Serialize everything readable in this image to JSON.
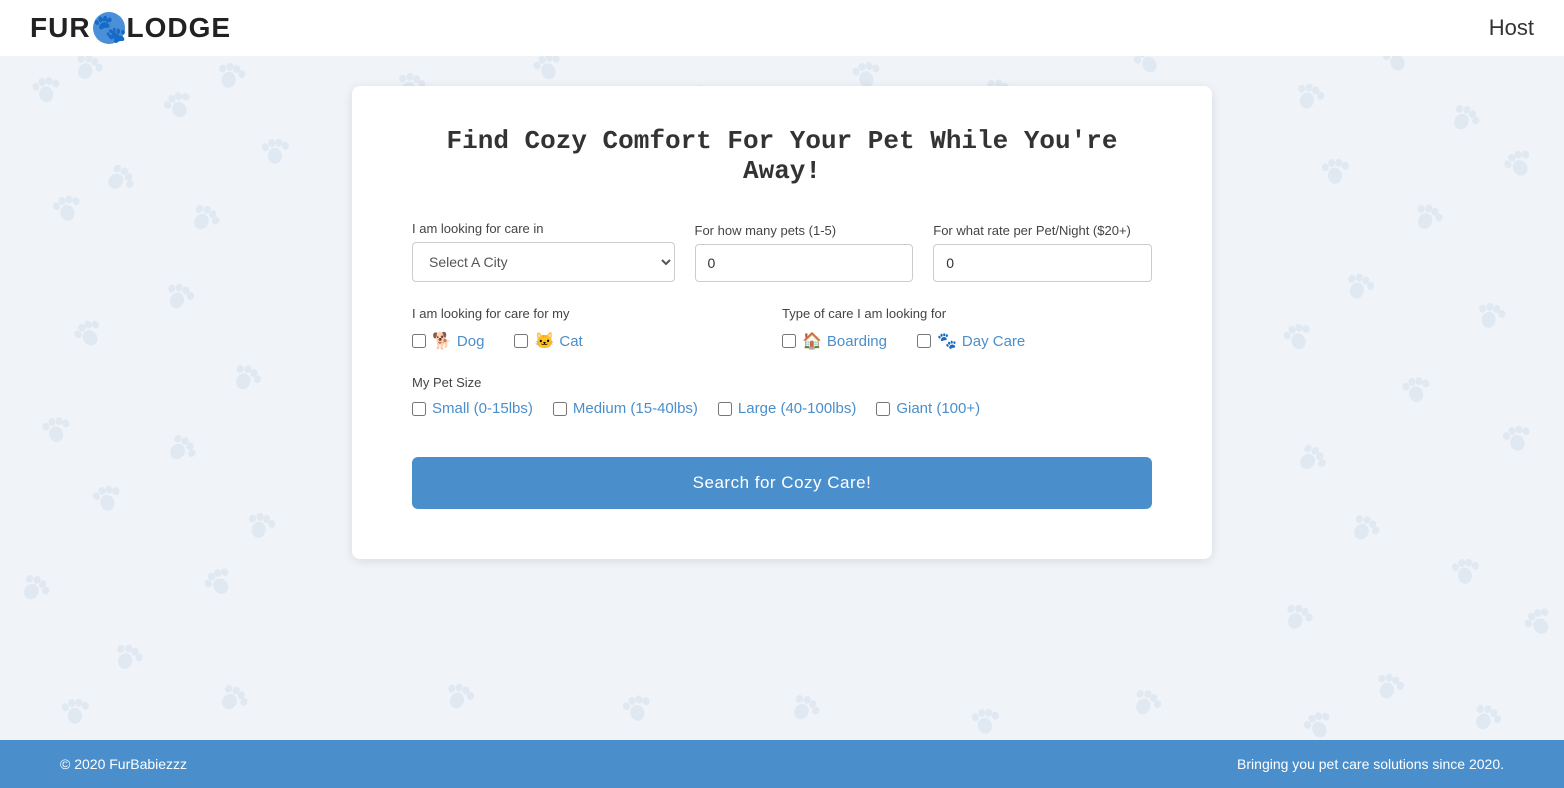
{
  "header": {
    "logo_text_before": "FUR",
    "logo_text_after": "ODGE",
    "host_label": "Host"
  },
  "page": {
    "title": "Find Cozy Comfort For Your Pet While You're Away!"
  },
  "form": {
    "city_label": "I am looking for care in",
    "city_placeholder": "Select A City",
    "pets_label": "For how many pets (1-5)",
    "pets_value": "0",
    "rate_label": "For what rate per Pet/Night ($20+)",
    "rate_value": "0",
    "care_for_label": "I am looking for care for my",
    "care_type_label": "Type of care I am looking for",
    "pet_size_label": "My Pet Size",
    "search_button_label": "Search for Cozy Care!"
  },
  "pet_types": [
    {
      "id": "dog",
      "label": "Dog",
      "icon": "🐕"
    },
    {
      "id": "cat",
      "label": "Cat",
      "icon": "🐱"
    }
  ],
  "care_types": [
    {
      "id": "boarding",
      "label": "Boarding",
      "icon": "🏠"
    },
    {
      "id": "daycare",
      "label": "Day Care",
      "icon": "🐾"
    }
  ],
  "pet_sizes": [
    {
      "id": "small",
      "label": "Small (0-15lbs)"
    },
    {
      "id": "medium",
      "label": "Medium (15-40lbs)"
    },
    {
      "id": "large",
      "label": "Large (40-100lbs)"
    },
    {
      "id": "giant",
      "label": "Giant (100+)"
    }
  ],
  "footer": {
    "copyright": "© 2020 FurBabiezzz",
    "tagline": "Bringing you pet care solutions since 2020."
  }
}
